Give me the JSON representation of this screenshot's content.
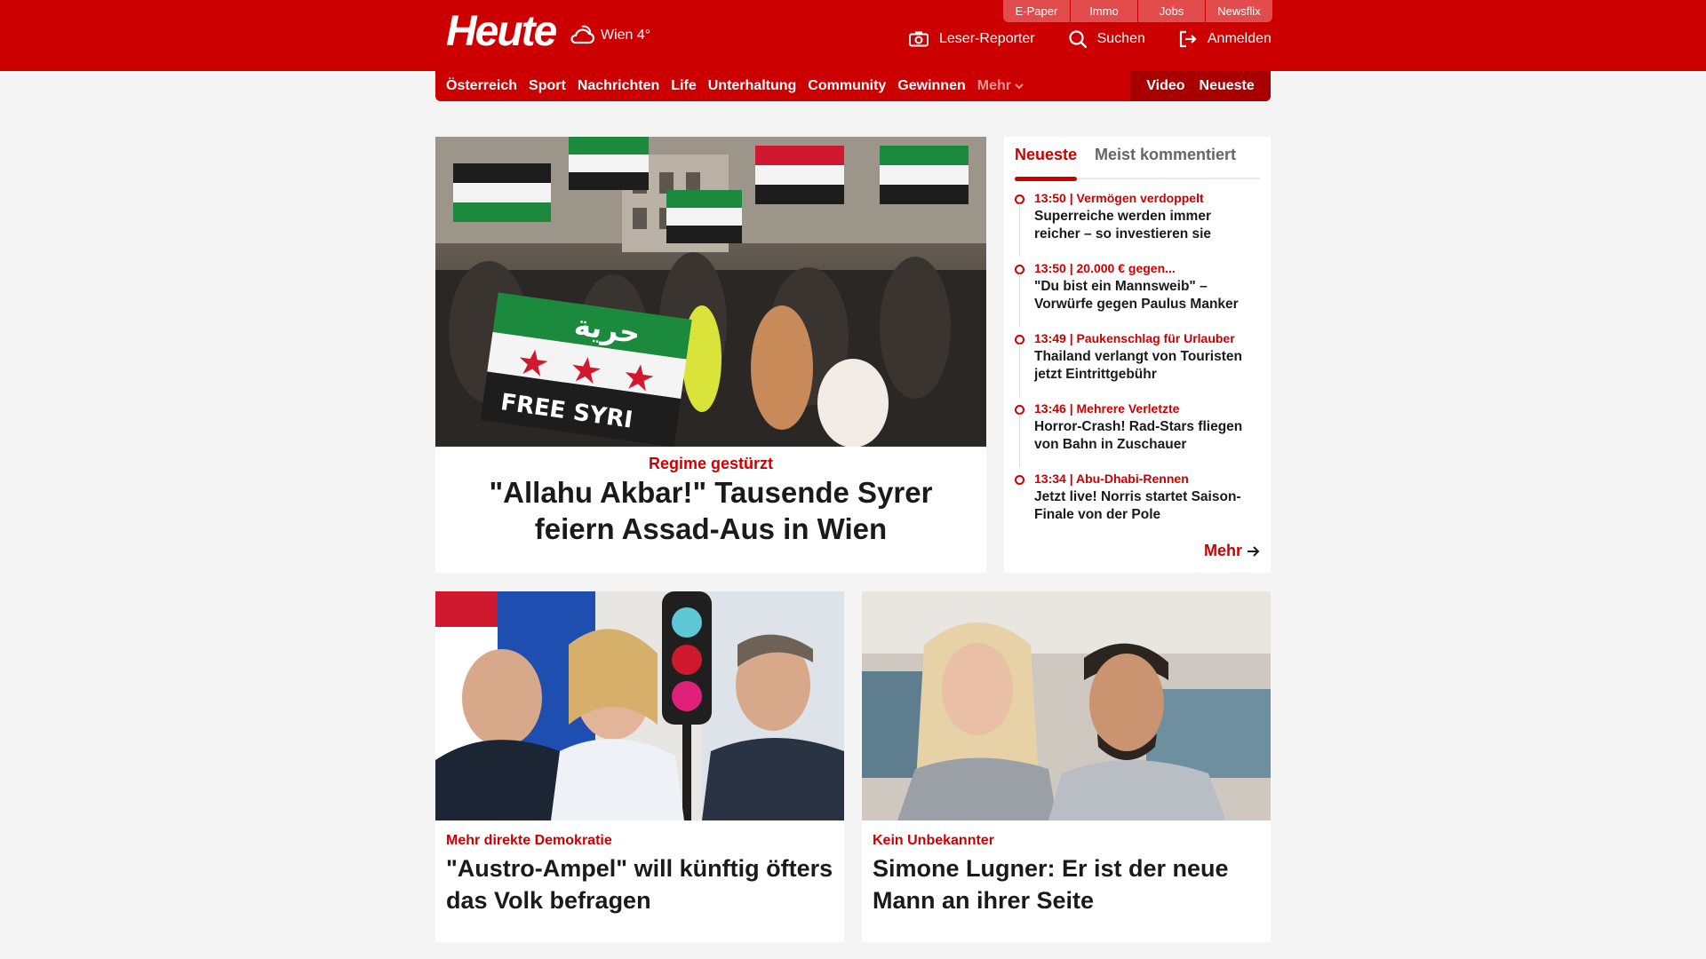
{
  "header": {
    "logo": "Heute",
    "weather": "Wien 4°",
    "service_tabs": [
      "E-Paper",
      "Immo",
      "Jobs",
      "Newsflix"
    ],
    "tools": {
      "reporter": "Leser-Reporter",
      "search": "Suchen",
      "login": "Anmelden"
    }
  },
  "nav": {
    "items": [
      "Österreich",
      "Sport",
      "Nachrichten",
      "Life",
      "Unterhaltung",
      "Community",
      "Gewinnen"
    ],
    "more": "Mehr",
    "right": [
      "Video",
      "Neueste"
    ]
  },
  "hero": {
    "kicker": "Regime gestürzt",
    "title": "\"Allahu Akbar!\" Tausende Syrer feiern Assad-Aus in Wien",
    "image_text": {
      "flag_script": "حرية",
      "banner": "FREE SYRI"
    }
  },
  "sidebar": {
    "tabs": [
      "Neueste",
      "Meist kommentiert"
    ],
    "items": [
      {
        "meta": "13:50 | Vermögen verdoppelt",
        "title": "Superreiche werden immer reicher – so investieren sie"
      },
      {
        "meta": "13:50 | 20.000 € gegen...",
        "title": "\"Du bist ein Mannsweib\" – Vorwürfe gegen Paulus Manker"
      },
      {
        "meta": "13:49 | Paukenschlag für Urlauber",
        "title": "Thailand verlangt von Touristen jetzt Eintrittgebühr"
      },
      {
        "meta": "13:46 | Mehrere Verletzte",
        "title": "Horror-Crash! Rad-Stars fliegen von Bahn in Zuschauer"
      },
      {
        "meta": "13:34 | Abu-Dhabi-Rennen",
        "title": "Jetzt live! Norris startet Saison-Finale von der Pole"
      }
    ],
    "more": "Mehr"
  },
  "cards": [
    {
      "kicker": "Mehr direkte Demokratie",
      "title": "\"Austro-Ampel\" will künftig öfters das Volk befragen"
    },
    {
      "kicker": "Kein Unbekannter",
      "title": "Simone Lugner: Er ist der neue Mann an ihrer Seite"
    }
  ],
  "colors": {
    "brand": "#cc0000",
    "brand_dark": "#a80000",
    "tab_light": "#e24c4c",
    "background": "#f4f4f4"
  },
  "icons": {
    "weather": "cloud-sun-icon",
    "reporter": "camera-icon",
    "search": "search-icon",
    "login": "login-icon",
    "more": "chevron-down-icon",
    "arrow": "arrow-right-icon"
  }
}
